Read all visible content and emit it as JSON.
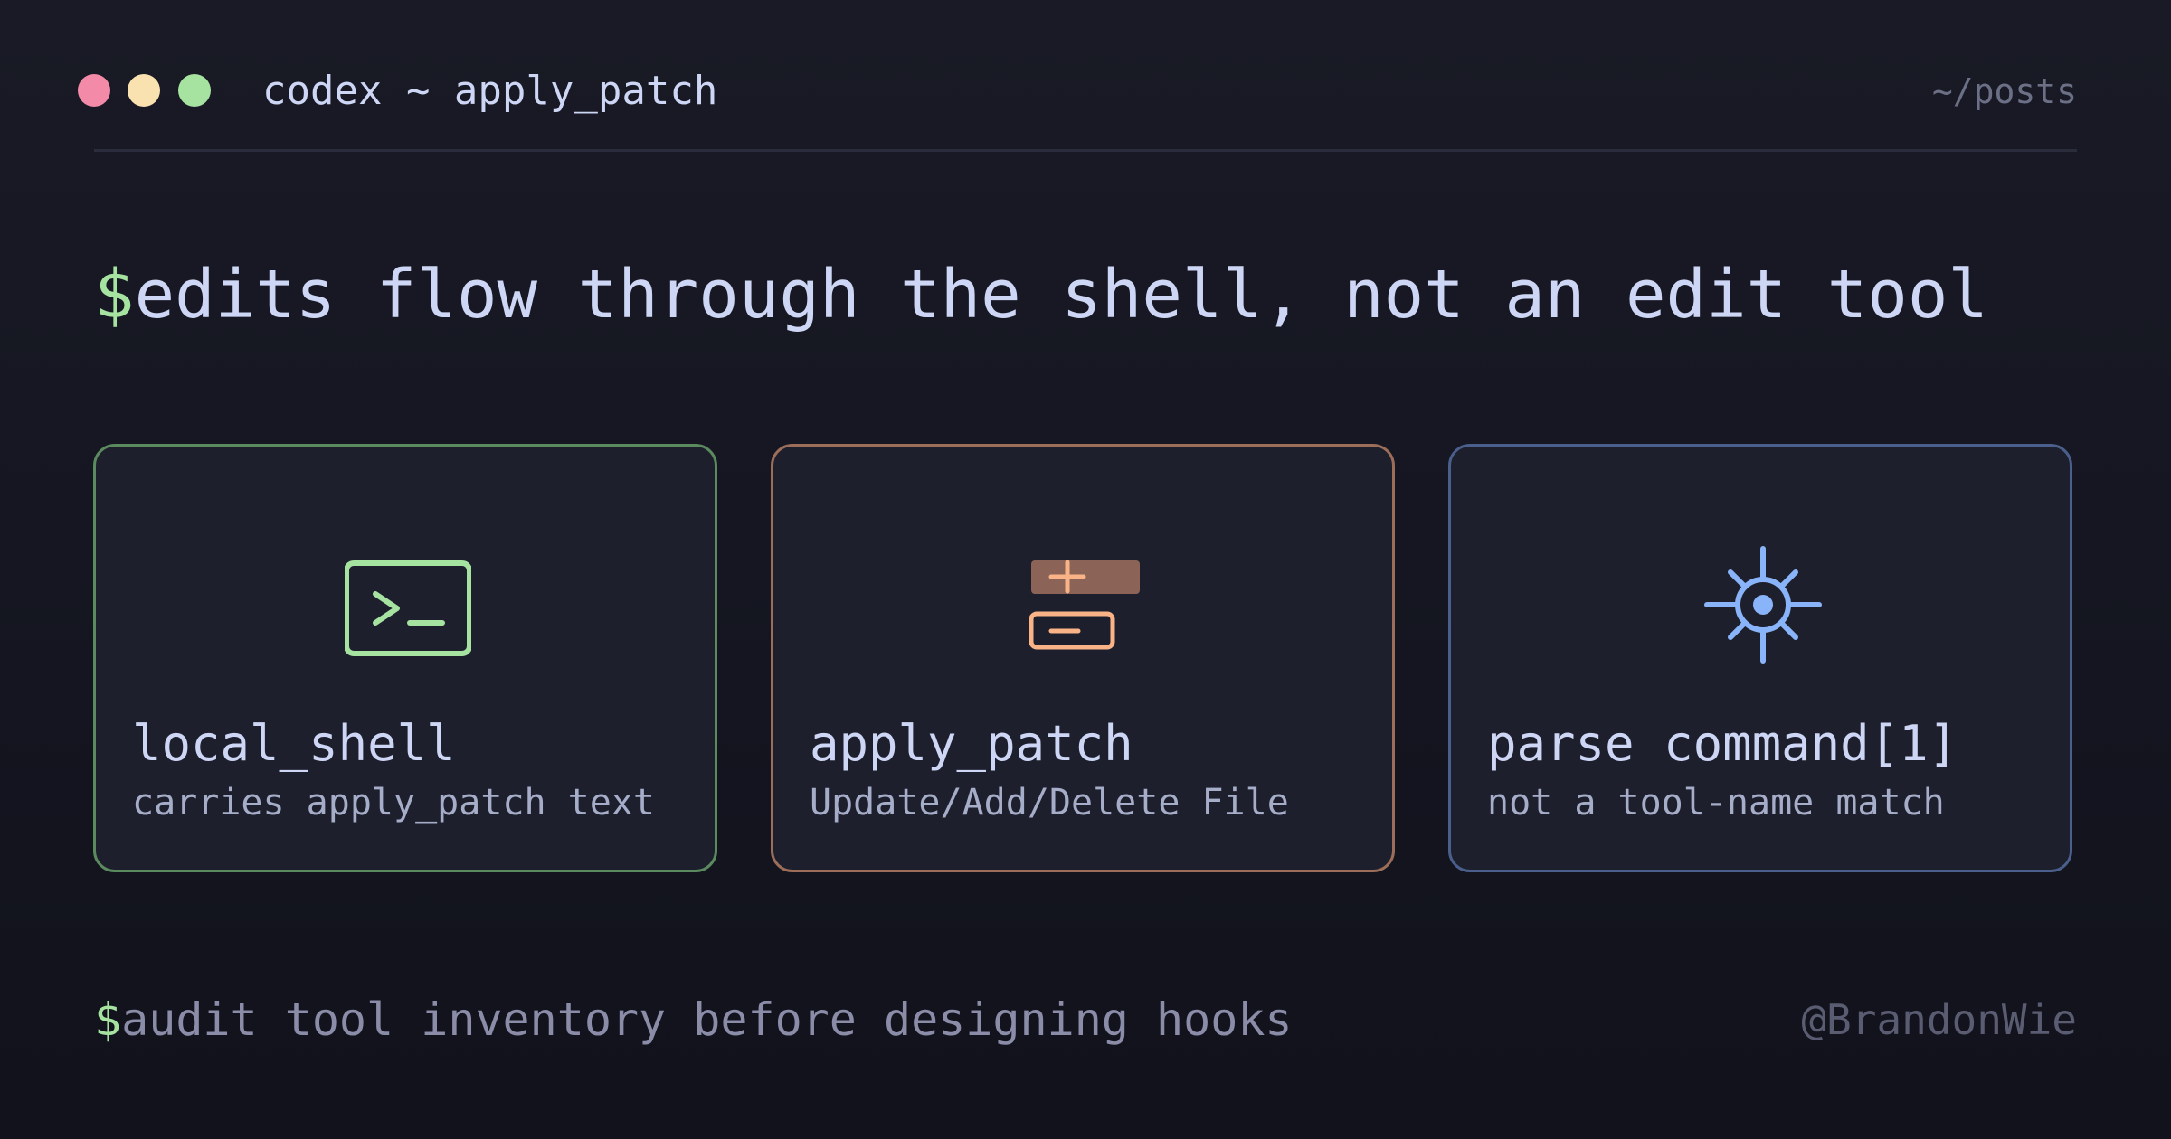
{
  "window": {
    "title": "codex ~ apply_patch",
    "path": "~/posts",
    "controls": [
      "close",
      "minimize",
      "maximize"
    ]
  },
  "headline": {
    "prompt": "$",
    "text": "edits flow through the shell, not an edit tool"
  },
  "cards": [
    {
      "icon": "terminal-icon",
      "title": "local_shell",
      "subtitle": "carries apply_patch text",
      "accent": "#a6e3a1"
    },
    {
      "icon": "diff-icon",
      "title": "apply_patch",
      "subtitle": "Update/Add/Delete File",
      "accent": "#fab387"
    },
    {
      "icon": "gear-icon",
      "title": "parse command[1]",
      "subtitle": "not a tool-name match",
      "accent": "#89b4fa"
    }
  ],
  "footer": {
    "prompt": "$",
    "text": "audit tool inventory before designing hooks",
    "handle": "@BrandonWie"
  },
  "colors": {
    "background": "#161722",
    "text": "#cdd6f4",
    "prompt": "#a6e3a1",
    "muted": "#6c7086"
  }
}
